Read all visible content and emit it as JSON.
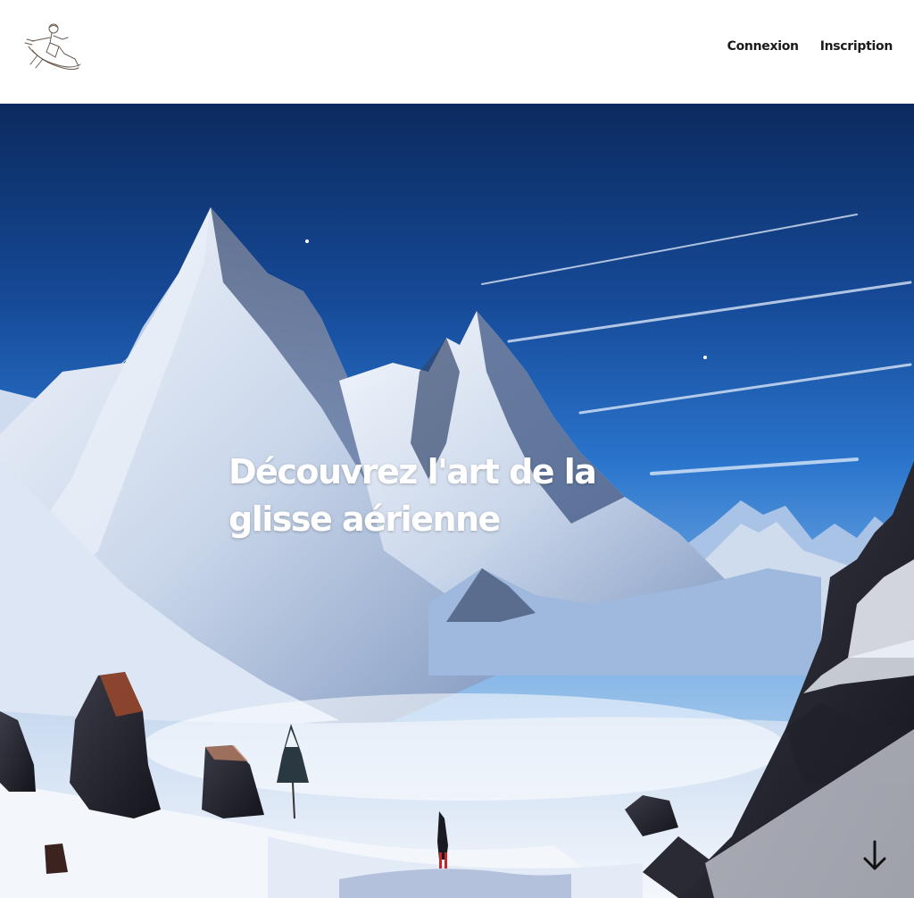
{
  "header": {
    "logo_icon": "skier-sketch-logo-icon",
    "nav": {
      "login_label": "Connexion",
      "signup_label": "Inscription"
    }
  },
  "hero": {
    "title": "Découvrez l'art de la glisse aérienne",
    "background": "snowy-mountain-illustration",
    "scroll_icon": "arrow-down-icon"
  },
  "colors": {
    "sky_top": "#0b2a5e",
    "sky_mid": "#1a5db8",
    "sky_low": "#5d9ee0",
    "snow": "#eef3fb",
    "rock": "#2a2a34",
    "title_text": "#ffffff",
    "nav_text": "#1b1b1b"
  }
}
